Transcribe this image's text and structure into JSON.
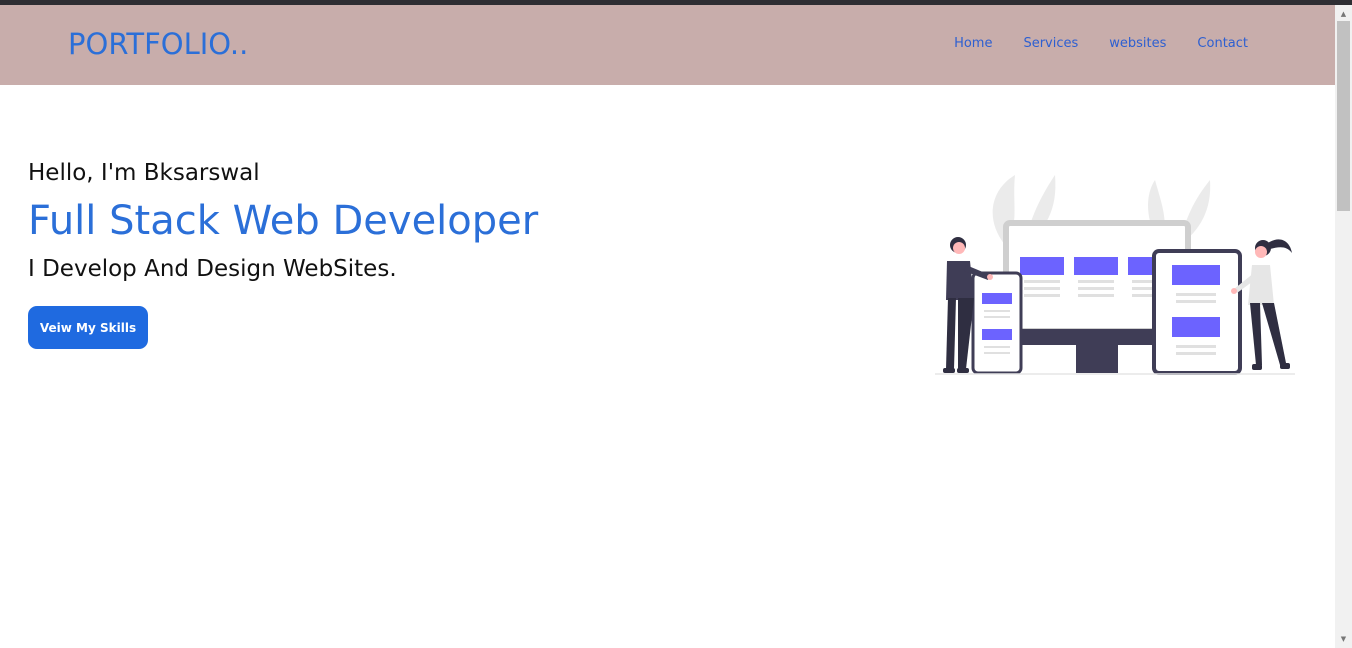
{
  "header": {
    "logo": "PORTFOLIO..",
    "nav": [
      {
        "label": "Home"
      },
      {
        "label": "Services"
      },
      {
        "label": "websites"
      },
      {
        "label": "Contact"
      }
    ]
  },
  "hero": {
    "greeting": "Hello, I'm Bksarswal",
    "title": "Full Stack Web Developer",
    "subtitle": "I Develop And Design WebSites.",
    "cta_label": "Veiw My Skills"
  },
  "colors": {
    "navbar_bg": "#c8adab",
    "accent": "#2b6fd8",
    "button": "#1f6ae0",
    "illustration_accent": "#6c63ff"
  },
  "icons": {
    "scroll_up": "scroll-up-arrow-icon",
    "scroll_down": "scroll-down-arrow-icon"
  }
}
